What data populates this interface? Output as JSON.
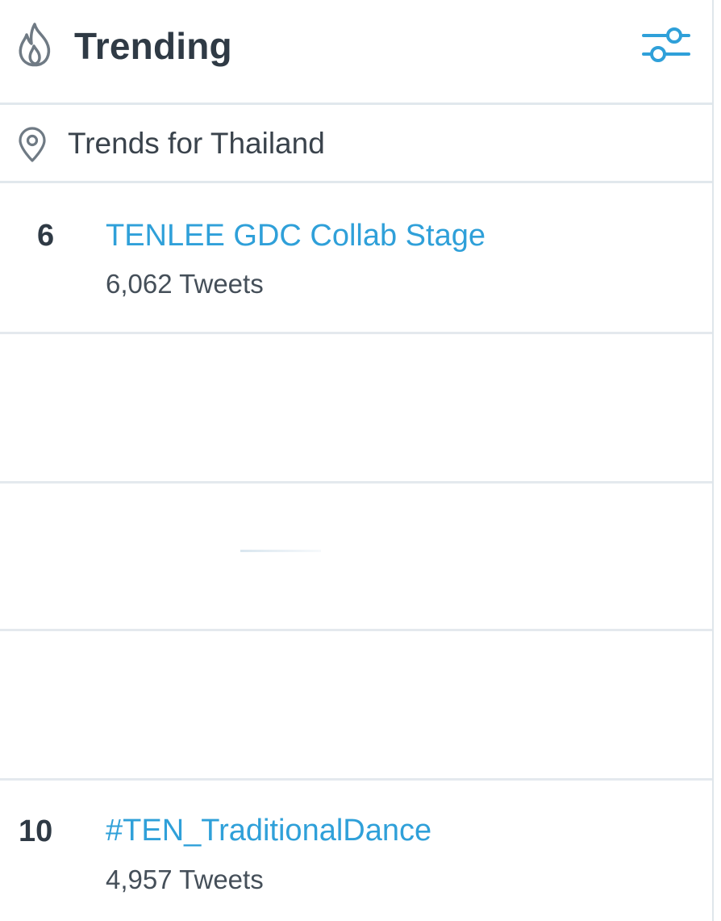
{
  "header": {
    "title": "Trending",
    "flame_icon": "flame-icon",
    "settings_icon": "sliders-icon"
  },
  "location": {
    "icon": "location-pin-icon",
    "label": "Trends for Thailand"
  },
  "trends": [
    {
      "rank": "6",
      "name": "TENLEE GDC Collab Stage",
      "count": "6,062 Tweets"
    },
    {
      "rank": "10",
      "name": "#TEN_TraditionalDance",
      "count": "4,957 Tweets"
    }
  ],
  "colors": {
    "accent": "#2fa0d9",
    "title_text": "#2f3a45",
    "secondary_text": "#454f59",
    "divider": "#e1e8ed"
  }
}
